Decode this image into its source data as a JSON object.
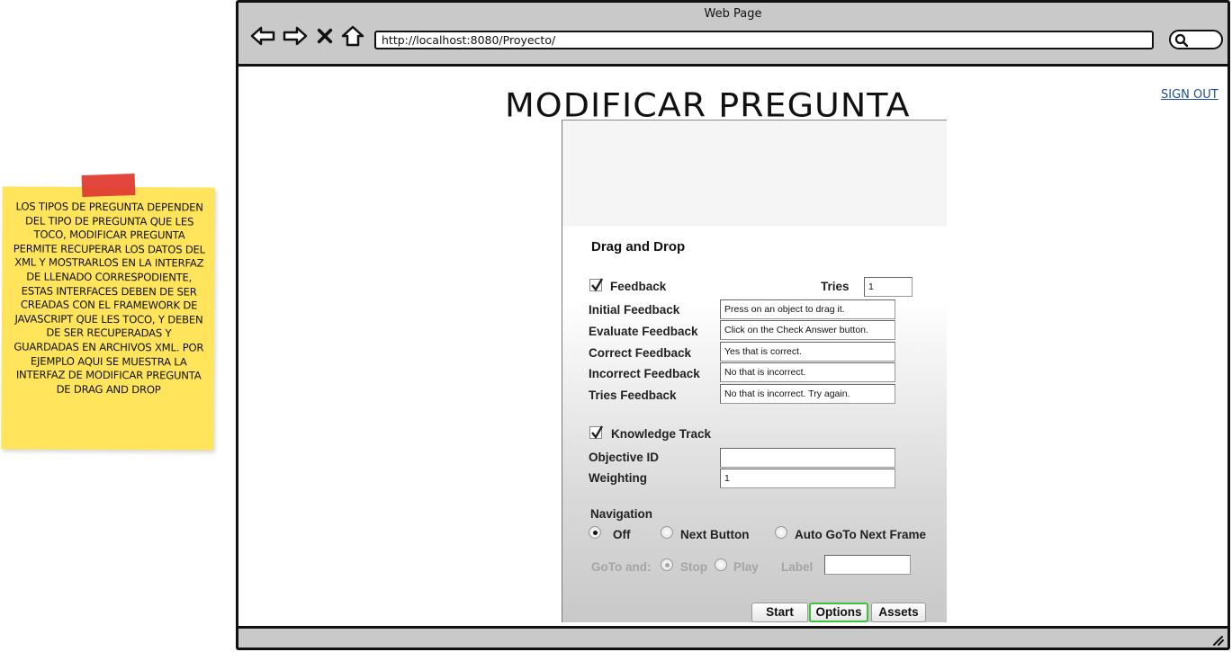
{
  "note": {
    "text": "Los tipos de pregunta dependen del tipo de pregunta que les toco, modificar pregunta permite recuperar los datos del XML y mostrarlos en la interfaz de llenado correspodiente, estas interfaces deben de ser creadas con el framework de javascript que les toco, y deben de ser recuperadas y guardadas en archivos XML. Por ejemplo aqui se muestra la interfaz de modificar pregunta de Drag and Drop",
    "tape_color": "#e03c31",
    "color": "#ffe45c"
  },
  "browser": {
    "title": "Web Page",
    "url": "http://localhost:8080/Proyecto/",
    "nav_icons": [
      "back-arrow-icon",
      "forward-arrow-icon",
      "stop-x-icon",
      "home-icon"
    ]
  },
  "page": {
    "title": "MODIFICAR PREGUNTA",
    "sign_out": "SIGN OUT",
    "link_color": "#1f4e9c"
  },
  "panel": {
    "title": "Drag and Drop",
    "feedback": {
      "checkbox_label": "Feedback",
      "checked": true,
      "tries_label": "Tries",
      "tries_value": "1",
      "rows": [
        {
          "label": "Initial Feedback",
          "value": "Press on an object to drag it."
        },
        {
          "label": "Evaluate Feedback",
          "value": "Click on the Check Answer button."
        },
        {
          "label": "Correct Feedback",
          "value": "Yes that is correct."
        },
        {
          "label": "Incorrect Feedback",
          "value": "No that is incorrect."
        },
        {
          "label": "Tries Feedback",
          "value": "No that is incorrect. Try again."
        }
      ]
    },
    "knowledge": {
      "checkbox_label": "Knowledge Track",
      "checked": true,
      "objective_label": "Objective ID",
      "objective_value": "",
      "weighting_label": "Weighting",
      "weighting_value": "1"
    },
    "navigation": {
      "label": "Navigation",
      "options": [
        "Off",
        "Next Button",
        "Auto GoTo Next Frame"
      ],
      "selected": "Off",
      "goto_label": "GoTo and:",
      "goto_options": [
        "Stop",
        "Play"
      ],
      "goto_selected": "Stop",
      "label_label": "Label",
      "label_value": ""
    },
    "tabs": [
      "Start",
      "Options",
      "Assets"
    ],
    "active_tab": "Options",
    "active_tab_color": "#3cc43c"
  }
}
